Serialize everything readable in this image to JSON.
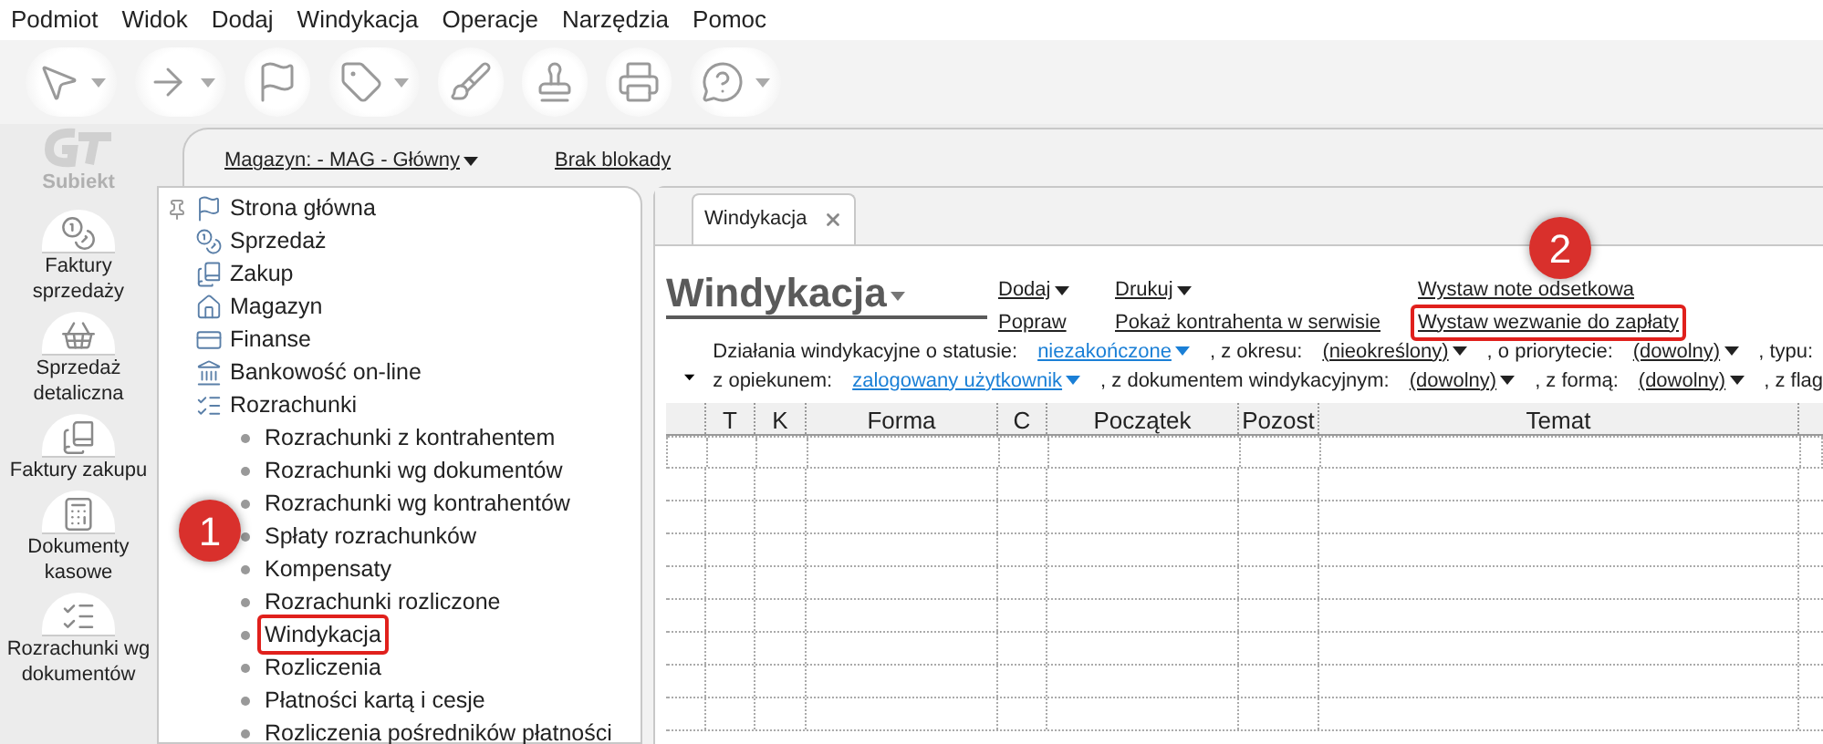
{
  "menu_bar": [
    "Podmiot",
    "Widok",
    "Dodaj",
    "Windykacja",
    "Operacje",
    "Narzędzia",
    "Pomoc"
  ],
  "toolbar": [
    {
      "menu": true
    },
    {
      "menu": true
    },
    {
      "menu": false
    },
    {
      "menu": true
    },
    {
      "menu": false
    },
    {
      "menu": false
    },
    {
      "menu": false
    },
    {
      "menu": true
    }
  ],
  "logo": {
    "text": "Subiekt"
  },
  "sidebar": [
    {
      "label": "Faktury sprzedaży"
    },
    {
      "label": "Sprzedaż detaliczna"
    },
    {
      "label": "Faktury zakupu"
    },
    {
      "label": "Dokumenty kasowe"
    },
    {
      "label": "Rozrachunki wg dokumentów"
    }
  ],
  "top_strip": [
    {
      "label": "Magazyn: - MAG - Główny",
      "menu": true
    },
    {
      "label": "Brak blokady",
      "menu": false
    }
  ],
  "tree": [
    {
      "label": "Strona główna"
    },
    {
      "label": "Sprzedaż"
    },
    {
      "label": "Zakup"
    },
    {
      "label": "Magazyn"
    },
    {
      "label": "Finanse"
    },
    {
      "label": "Bankowość on-line"
    },
    {
      "label": "Rozrachunki",
      "children": [
        {
          "label": "Rozrachunki z kontrahentem",
          "highlighted": false
        },
        {
          "label": "Rozrachunki wg dokumentów",
          "highlighted": false
        },
        {
          "label": "Rozrachunki wg kontrahentów",
          "highlighted": false
        },
        {
          "label": "Spłaty rozrachunków",
          "highlighted": false
        },
        {
          "label": "Kompensaty",
          "highlighted": false
        },
        {
          "label": "Rozrachunki rozliczone",
          "highlighted": false
        },
        {
          "label": "Windykacja",
          "highlighted": true
        },
        {
          "label": "Rozliczenia",
          "highlighted": false
        },
        {
          "label": "Płatności kartą i cesje",
          "highlighted": false
        },
        {
          "label": "Rozliczenia pośredników płatności",
          "highlighted": false
        }
      ]
    }
  ],
  "tabs": [
    {
      "label": "Windykacja",
      "selected": true
    }
  ],
  "view": {
    "title": "Windykacja",
    "actions": [
      [
        {
          "label": "Dodaj",
          "menu": true,
          "highlighted": false
        },
        {
          "label": "Popraw",
          "menu": false,
          "highlighted": false
        }
      ],
      [
        {
          "label": "Drukuj",
          "menu": true,
          "highlighted": false
        },
        {
          "label": "Pokaż kontrahenta w serwisie",
          "menu": false,
          "highlighted": false
        }
      ],
      [
        {
          "label": "Wystaw note odsetkowa",
          "menu": false,
          "highlighted": false
        },
        {
          "label": "Wystaw wezwanie do zapłaty",
          "menu": false,
          "highlighted": true
        }
      ]
    ],
    "filters": [
      [
        {
          "kind": "label",
          "text": "Działania windykacyjne o statusie:"
        },
        {
          "kind": "link",
          "text": "niezakończone"
        },
        {
          "kind": "label",
          "text": ", z okresu:"
        },
        {
          "kind": "dropdown",
          "text": "(nieokreślony)"
        },
        {
          "kind": "label",
          "text": ", o priorytecie:"
        },
        {
          "kind": "dropdown",
          "text": "(dowolny)"
        },
        {
          "kind": "label",
          "text": ", typu:"
        }
      ],
      [
        {
          "kind": "label",
          "text": "z opiekunem:"
        },
        {
          "kind": "link",
          "text": "zalogowany użytkownik"
        },
        {
          "kind": "label",
          "text": ", z dokumentem windykacyjnym:"
        },
        {
          "kind": "dropdown",
          "text": "(dowolny)"
        },
        {
          "kind": "label",
          "text": ", z formą:"
        },
        {
          "kind": "dropdown",
          "text": "(dowolny)"
        },
        {
          "kind": "label",
          "text": ", z flag"
        }
      ]
    ],
    "table": {
      "columns": [
        "T",
        "K",
        "Forma",
        "C",
        "Początek",
        "Pozost",
        "Temat"
      ]
    }
  },
  "callouts": [
    {
      "number": "1"
    },
    {
      "number": "2"
    }
  ]
}
